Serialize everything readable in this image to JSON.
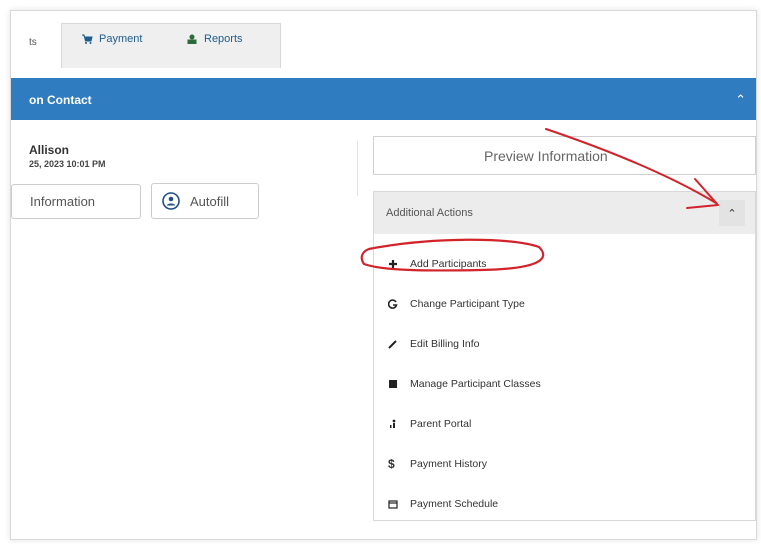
{
  "tabs": {
    "cut_label": "ts",
    "items": [
      {
        "label": "Payment",
        "icon": "cart-icon"
      },
      {
        "label": "Reports",
        "icon": "reports-icon"
      }
    ]
  },
  "section": {
    "title": "on Contact",
    "collapse_icon": "chevron-up-icon"
  },
  "contact": {
    "name": "Allison",
    "date": "25, 2023 10:01 PM"
  },
  "buttons": {
    "information": "Information",
    "autofill": "Autofill",
    "preview": "Preview Information"
  },
  "actions": {
    "title": "Additional Actions",
    "items": [
      {
        "label": "Add Participants",
        "icon": "plus-icon"
      },
      {
        "label": "Change Participant Type",
        "icon": "change-icon"
      },
      {
        "label": "Edit Billing Info",
        "icon": "pencil-icon"
      },
      {
        "label": "Manage Participant Classes",
        "icon": "book-icon"
      },
      {
        "label": "Parent Portal",
        "icon": "family-icon"
      },
      {
        "label": "Payment History",
        "icon": "dollar-icon"
      },
      {
        "label": "Payment Schedule",
        "icon": "calendar-icon"
      }
    ]
  },
  "colors": {
    "header_blue": "#2f7cc0",
    "annotation_red": "#d2232a"
  }
}
